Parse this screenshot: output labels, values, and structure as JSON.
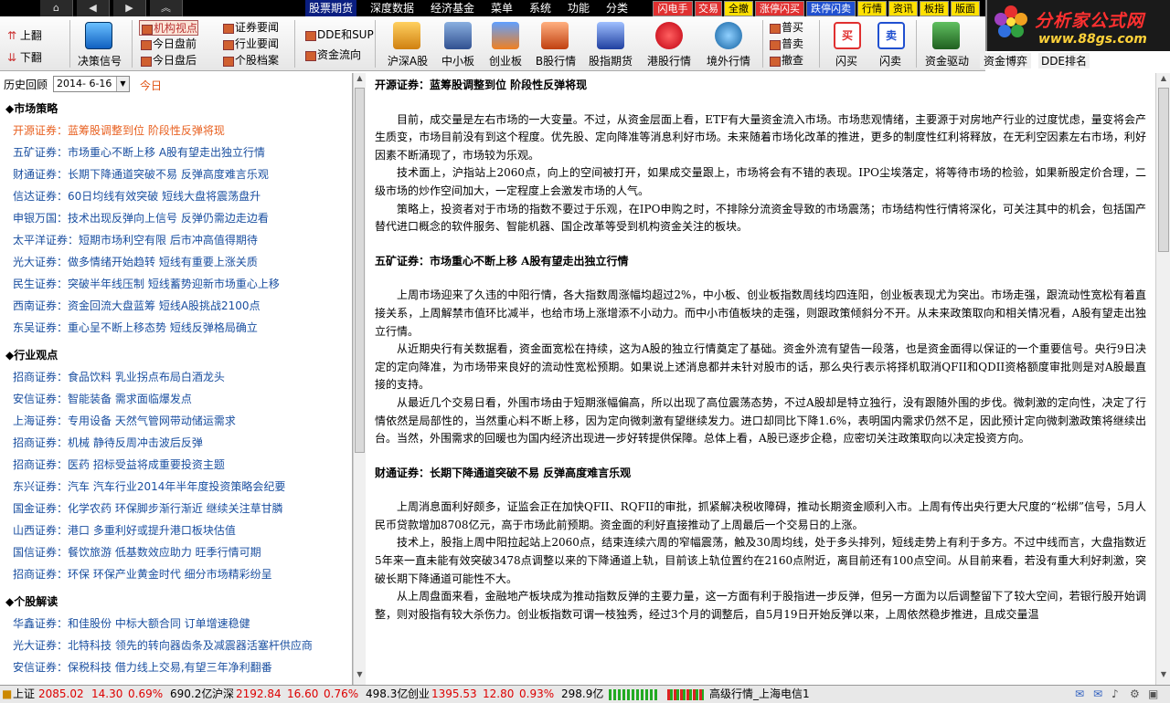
{
  "menubar": {
    "items": [
      "股票期货",
      "深度数据",
      "经济基金",
      "菜单",
      "系统",
      "功能",
      "分类"
    ],
    "red_tabs": [
      "闪电手",
      "交易",
      "全撤",
      "涨停闪买",
      "跌停闪卖",
      "行情",
      "资讯",
      "板指",
      "版面"
    ]
  },
  "logo": {
    "title": "分析家公式网",
    "url": "www.88gs.com"
  },
  "toolbar": {
    "up": "上翻",
    "down": "下翻",
    "decision": "决策信号",
    "col1": [
      "机构视点",
      "今日盘前",
      "今日盘后"
    ],
    "col2": [
      "证券要闻",
      "行业要闻",
      "个股档案"
    ],
    "col3": [
      "DDE和SUP",
      "资金流向"
    ],
    "icons": [
      "沪深A股",
      "中小板",
      "创业板",
      "B股行情",
      "股指期货",
      "港股行情",
      "境外行情"
    ],
    "col4": [
      "普买",
      "普卖",
      "撤查"
    ],
    "icons2": [
      "闪买",
      "闪卖",
      "资金驱动",
      "资金博弈",
      "DDE排名"
    ]
  },
  "left": {
    "hist_label": "历史回顾",
    "date": "2014- 6-16",
    "today": "今日",
    "sections": [
      {
        "title": "◆市场策略",
        "items": [
          "开源证券：蓝筹股调整到位 阶段性反弹将现",
          "五矿证券：市场重心不断上移 A股有望走出独立行情",
          "财通证券：长期下降通道突破不易 反弹高度难言乐观",
          "信达证券：60日均线有效突破 短线大盘将震荡盘升",
          "申银万国：技术出现反弹向上信号 反弹仍需边走边看",
          "太平洋证券：短期市场利空有限 后市冲高值得期待",
          "光大证券：做多情绪开始趋转 短线有重要上涨关质",
          "民生证券：突破半年线压制 短线蓄势迎新市场重心上移",
          "西南证券：资金回流大盘蓝筹 短线A股挑战2100点",
          "东吴证券：重心呈不断上移态势 短线反弹格局确立"
        ]
      },
      {
        "title": "◆行业观点",
        "items": [
          "招商证券：食品饮料 乳业拐点布局白酒龙头",
          "安信证券：智能装备 需求面临爆发点",
          "上海证券：专用设备 天然气管网带动储运需求",
          "招商证券：机械 静待反周冲击波后反弹",
          "招商证券：医药 招标受益将成重要投资主题",
          "东兴证券：汽车 汽车行业2014年半年度投资策略会纪要",
          "国金证券：化学农药 环保脚步渐行渐近 继续关注草甘膦",
          "山西证券：港口 多重利好或提升港口板块估值",
          "国信证券：餐饮旅游 低基数效应助力 旺季行情可期",
          "招商证券：环保 环保产业黄金时代 细分市场精彩纷呈"
        ]
      },
      {
        "title": "◆个股解读",
        "items": [
          "华鑫证券：和佳股份 中标大额合同 订单增速稳健",
          "光大证券：北特科技 领先的转向器齿条及减震器活塞杆供应商",
          "安信证券：保税科技 借力线上交易,有望三年净利翻番"
        ]
      }
    ]
  },
  "articles": [
    {
      "title": "开源证券：蓝筹股调整到位 阶段性反弹将现",
      "paras": [
        "目前，成交量是左右市场的一大变量。不过，从资金层面上看，ETF有大量资金流入市场。市场悲观情绪，主要源于对房地产行业的过度忧虑，量变将会产生质变，市场目前没有到这个程度。优先股、定向降准等消息利好市场。未来随着市场化改革的推进，更多的制度性红利将释放，在无利空因素左右市场，利好因素不断涌现了，市场较为乐观。",
        "技术面上，沪指站上2060点，向上的空间被打开，如果成交量跟上，市场将会有不错的表现。IPO尘埃落定，将等待市场的检验，如果新股定价合理，二级市场的炒作空间加大，一定程度上会激发市场的人气。",
        "策略上，投资者对于市场的指数不要过于乐观，在IPO申购之时，不排除分流资金导致的市场震荡；市场结构性行情将深化，可关注其中的机会，包括国产替代进口概念的软件服务、智能机器、国企改革等受到机构资金关注的板块。"
      ]
    },
    {
      "title": "五矿证券：市场重心不断上移 A股有望走出独立行情",
      "paras": [
        "上周市场迎来了久违的中阳行情，各大指数周涨幅均超过2%，中小板、创业板指数周线均四连阳，创业板表现尤为突出。市场走强，跟流动性宽松有着直接关系，上周解禁市值环比减半，也给市场上涨增添不小动力。而中小市值板块的走强，则跟政策倾斜分不开。从未来政策取向和相关情况看，A股有望走出独立行情。",
        "从近期央行有关数据看，资金面宽松在持续，这为A股的独立行情奠定了基础。资金外流有望告一段落，也是资金面得以保证的一个重要信号。央行9日决定的定向降准，为市场带来良好的流动性宽松预期。如果说上述消息都并未针对股市的话，那么央行表示将择机取消QFII和QDII资格额度审批则是对A股最直接的支持。",
        "从最近几个交易日看，外围市场由于短期涨幅偏高，所以出现了高位震荡态势，不过A股却是特立独行，没有跟随外围的步伐。微刺激的定向性，决定了行情依然是局部性的，当然重心料不断上移，因为定向微刺激有望继续发力。进口却同比下降1.6%，表明国内需求仍然不足，因此预计定向微刺激政策将继续出台。当然，外围需求的回暖也为国内经济出现进一步好转提供保障。总体上看，A股已逐步企稳，应密切关注政策取向以决定投资方向。"
      ]
    },
    {
      "title": "财通证券：长期下降通道突破不易 反弹高度难言乐观",
      "paras": [
        "上周消息面利好颇多，证监会正在加快QFII、RQFII的审批，抓紧解决税收障碍，推动长期资金顺利入市。上周有传出央行更大尺度的“松绑”信号，5月人民币贷款增加8708亿元，高于市场此前预期。资金面的利好直接推动了上周最后一个交易日的上涨。",
        "技术上，股指上周中阳拉起站上2060点，结束连续六周的窄幅震荡，触及30周均线，处于多头排列，短线走势上有利于多方。不过中线而言，大盘指数近5年来一直未能有效突破3478点调整以来的下降通道上轨，目前该上轨位置约在2160点附近，离目前还有100点空间。从目前来看，若没有重大利好刺激，突破长期下降通道可能性不大。",
        "从上周盘面来看，金融地产板块成为推动指数反弹的主要力量，这一方面有利于股指进一步反弹，但另一方面为以后调整留下了较大空间，若银行股开始调整，则对股指有较大杀伤力。创业板指数可谓一枝独秀，经过3个月的调整后，自5月19日开始反弹以来，上周依然稳步推进，且成交量温"
      ]
    }
  ],
  "status": {
    "sh_label": "上证",
    "sh_val": "2085.02",
    "sh_chg": "14.30",
    "sh_pct": "0.69%",
    "sh_amt": "690.2亿",
    "hs_label": "沪深",
    "hs_val": "2192.84",
    "hs_chg": "16.60",
    "hs_pct": "0.76%",
    "hs_amt": "498.3亿",
    "cy_label": "创业",
    "cy_val": "1395.53",
    "cy_chg": "12.80",
    "cy_pct": "0.93%",
    "cy_amt": "298.9亿",
    "server": "高级行情_上海电信1"
  }
}
